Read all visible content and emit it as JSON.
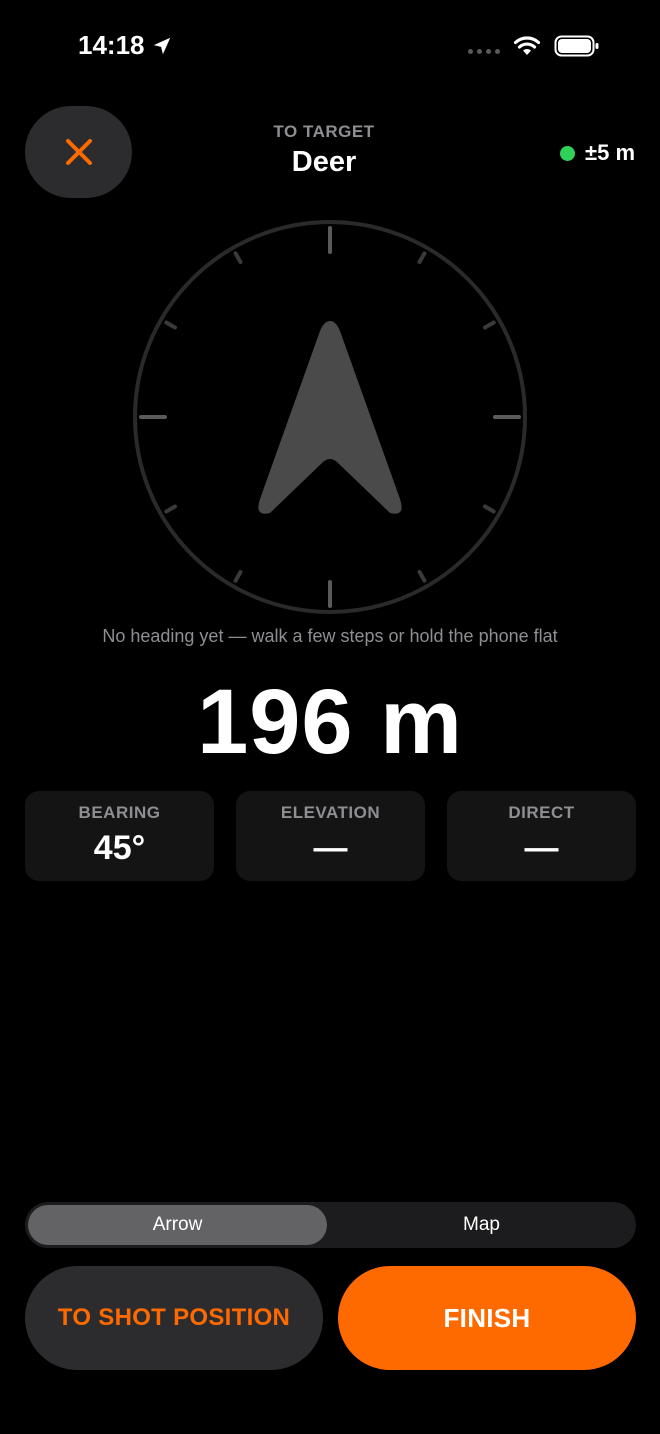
{
  "status_bar": {
    "time": "14:18"
  },
  "header": {
    "subtitle": "TO TARGET",
    "title": "Deer",
    "accuracy": "±5 m"
  },
  "compass": {
    "hint": "No heading yet — walk a few steps or hold the phone flat"
  },
  "distance": "196 m",
  "cards": [
    {
      "label": "BEARING",
      "value": "45°"
    },
    {
      "label": "ELEVATION",
      "value": "—"
    },
    {
      "label": "DIRECT",
      "value": "—"
    }
  ],
  "view_toggle": {
    "options": [
      "Arrow",
      "Map"
    ],
    "selected": "Arrow"
  },
  "actions": {
    "shot_position_label": "TO SHOT POSITION",
    "finish_label": "FINISH"
  },
  "colors": {
    "accent": "#ff6a00",
    "gps_ok": "#30d158",
    "background": "#000000"
  }
}
